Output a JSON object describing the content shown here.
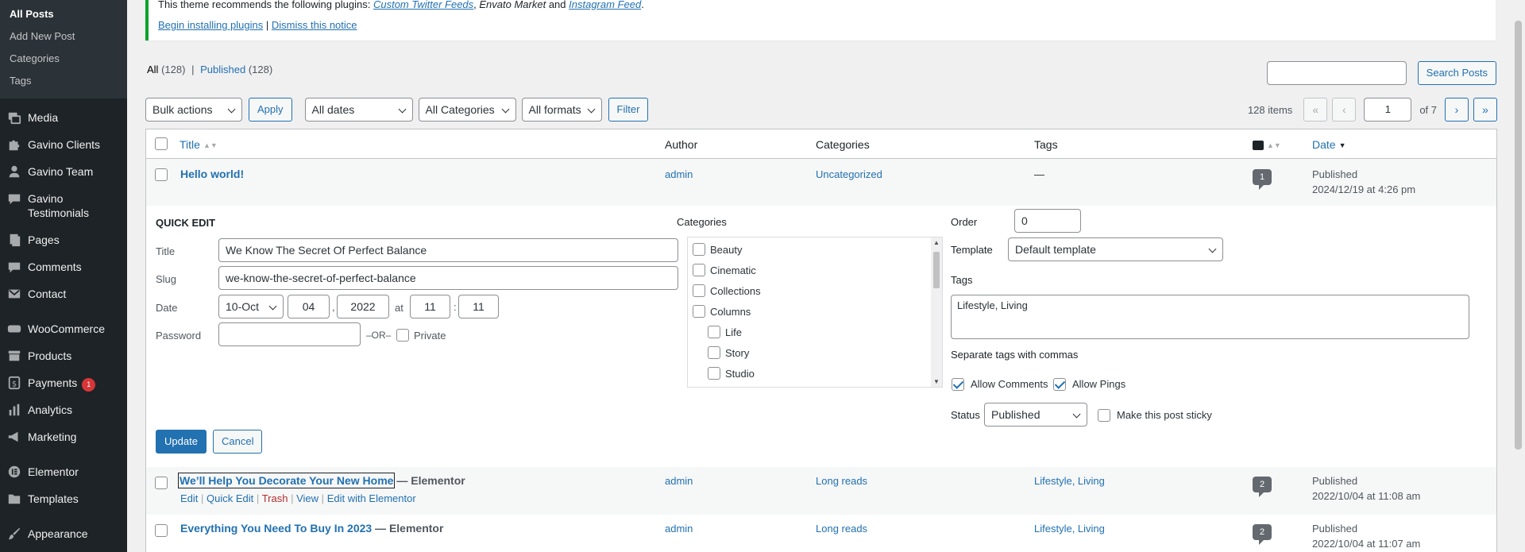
{
  "sidebar": {
    "submenu": [
      "All Posts",
      "Add New Post",
      "Categories",
      "Tags"
    ],
    "items": [
      {
        "label": "Media",
        "icon": "media-icon"
      },
      {
        "label": "Gavino Clients",
        "icon": "puzzle-icon"
      },
      {
        "label": "Gavino Team",
        "icon": "user-icon"
      },
      {
        "label": "Gavino Testimonials",
        "icon": "comment-icon"
      },
      {
        "label": "Pages",
        "icon": "page-icon"
      },
      {
        "label": "Comments",
        "icon": "comment-icon"
      },
      {
        "label": "Contact",
        "icon": "mail-icon"
      },
      {
        "label": "WooCommerce",
        "icon": "woo-icon"
      },
      {
        "label": "Products",
        "icon": "archive-icon"
      },
      {
        "label": "Payments",
        "icon": "dollar-icon",
        "badge": "1"
      },
      {
        "label": "Analytics",
        "icon": "chart-icon"
      },
      {
        "label": "Marketing",
        "icon": "megaphone-icon"
      },
      {
        "label": "Elementor",
        "icon": "elementor-icon"
      },
      {
        "label": "Templates",
        "icon": "folder-icon"
      },
      {
        "label": "Appearance",
        "icon": "brush-icon"
      }
    ]
  },
  "notice": {
    "text_before": "This theme recommends the following plugins: ",
    "plugin1": "Custom Twitter Feeds",
    "sep1": ", ",
    "plugin2": "Envato Market",
    "and": " and ",
    "plugin3": "Instagram Feed",
    "end": ".",
    "begin_link": "Begin installing plugins",
    "pipe": " | ",
    "dismiss_link": "Dismiss this notice"
  },
  "filters": {
    "all": "All",
    "all_count": "(128)",
    "sep": "|",
    "published": "Published",
    "published_count": "(128)"
  },
  "search": {
    "button": "Search Posts",
    "value": ""
  },
  "tablenav": {
    "bulk": "Bulk actions",
    "apply": "Apply",
    "dates": "All dates",
    "categories": "All Categories",
    "formats": "All formats",
    "filter": "Filter",
    "items": "128 items",
    "first": "«",
    "prev": "‹",
    "page": "1",
    "of": "of 7",
    "next": "›",
    "last": "»"
  },
  "columns": {
    "title": "Title",
    "author": "Author",
    "categories": "Categories",
    "tags": "Tags",
    "date": "Date"
  },
  "rows": [
    {
      "title": "Hello world!",
      "suffix": "",
      "author": "admin",
      "category": "Uncategorized",
      "tags": "—",
      "comments": "1",
      "status": "Published",
      "date": "2024/12/19 at 4:26 pm"
    },
    {
      "title": "We’ll Help You Decorate Your New Home",
      "suffix": " — Elementor",
      "author": "admin",
      "category": "Long reads",
      "tags": "Lifestyle, Living",
      "comments": "2",
      "status": "Published",
      "date": "2022/10/04 at 11:08 am"
    },
    {
      "title": "Everything You Need To Buy In 2023",
      "suffix": " — Elementor",
      "author": "admin",
      "category": "Long reads",
      "tags": "Lifestyle, Living",
      "comments": "2",
      "status": "Published",
      "date": "2022/10/04 at 11:07 am"
    }
  ],
  "row_actions": {
    "edit": "Edit",
    "quick_edit": "Quick Edit",
    "trash": "Trash",
    "view": "View",
    "edit_elementor": "Edit with Elementor",
    "sep": "|"
  },
  "quick_edit": {
    "heading": "QUICK EDIT",
    "title_label": "Title",
    "title_value": "We Know The Secret Of Perfect Balance",
    "slug_label": "Slug",
    "slug_value": "we-know-the-secret-of-perfect-balance",
    "date_label": "Date",
    "month": "10-Oct",
    "day": "04",
    "comma": ",",
    "year": "2022",
    "at": "at",
    "hour": "11",
    "colon": ":",
    "minute": "11",
    "password_label": "Password",
    "or": "–OR–",
    "private": "Private",
    "categories_label": "Categories",
    "categories": [
      {
        "name": "Beauty",
        "level": 0
      },
      {
        "name": "Cinematic",
        "level": 0
      },
      {
        "name": "Collections",
        "level": 0
      },
      {
        "name": "Columns",
        "level": 0
      },
      {
        "name": "Life",
        "level": 1
      },
      {
        "name": "Story",
        "level": 1
      },
      {
        "name": "Studio",
        "level": 1
      }
    ],
    "order_label": "Order",
    "order_value": "0",
    "template_label": "Template",
    "template_value": "Default template",
    "tags_label": "Tags",
    "tags_value": "Lifestyle, Living",
    "tags_hint": "Separate tags with commas",
    "allow_comments": "Allow Comments",
    "allow_pings": "Allow Pings",
    "status_label": "Status",
    "status_value": "Published",
    "sticky": "Make this post sticky",
    "update": "Update",
    "cancel": "Cancel"
  }
}
